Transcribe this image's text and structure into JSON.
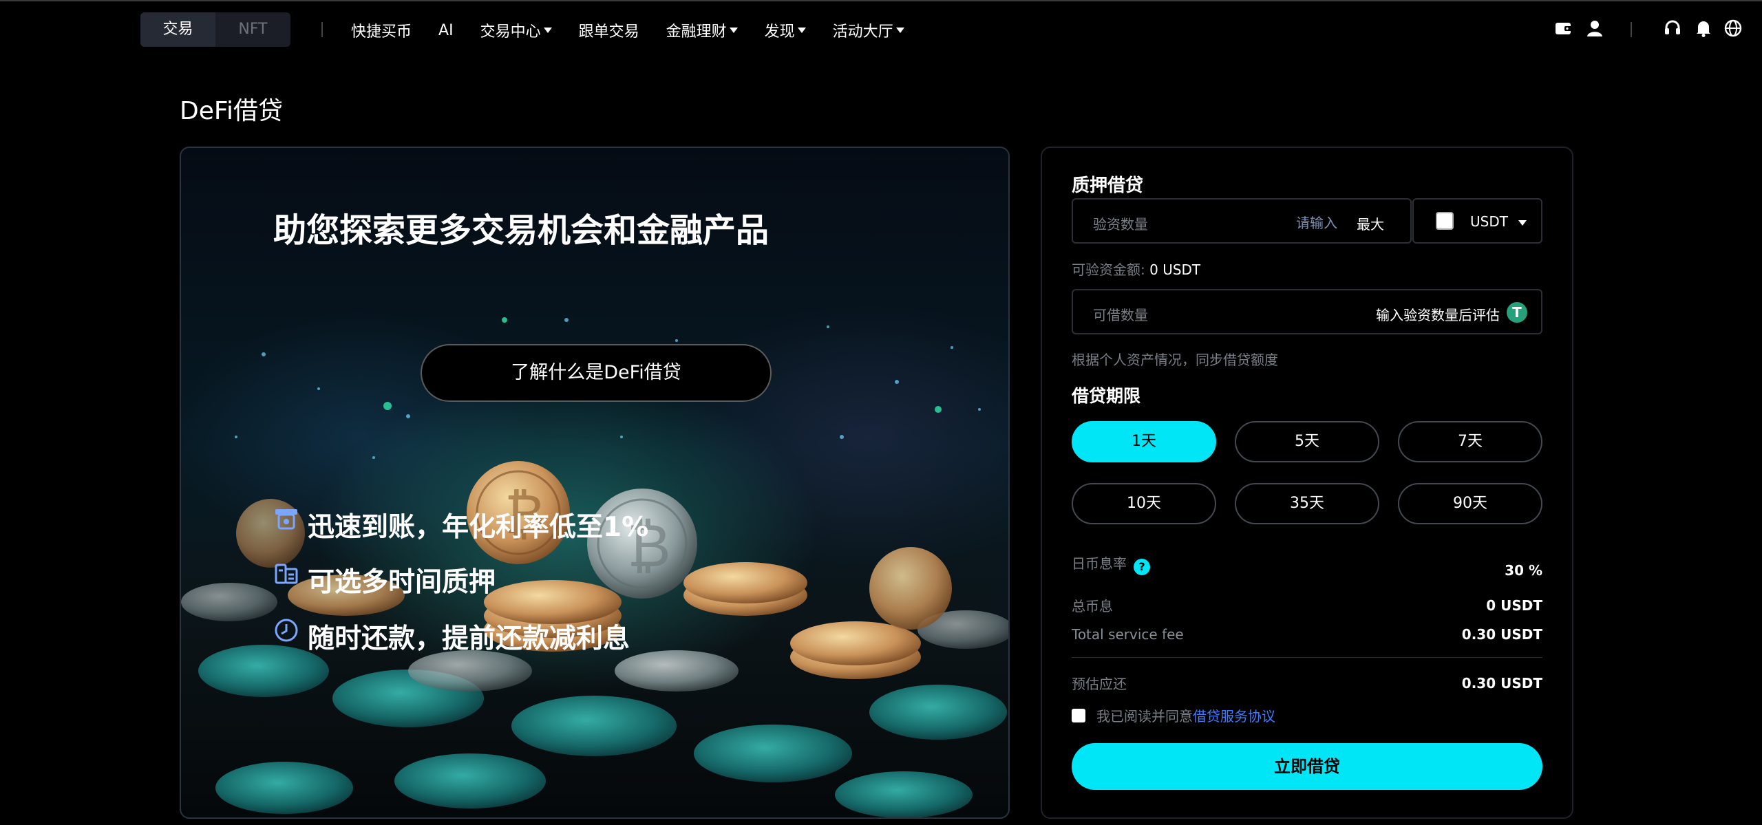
{
  "nav": {
    "segment": [
      "交易",
      "NFT"
    ],
    "menu": [
      {
        "label": "快捷买币",
        "dropdown": false
      },
      {
        "label": "AI",
        "dropdown": false
      },
      {
        "label": "交易中心",
        "dropdown": true
      },
      {
        "label": "跟单交易",
        "dropdown": false
      },
      {
        "label": "金融理财",
        "dropdown": true
      },
      {
        "label": "发现",
        "dropdown": true
      },
      {
        "label": "活动大厅",
        "dropdown": true
      }
    ],
    "right_icons": [
      "wallet-icon",
      "user-icon",
      "headset-icon",
      "bell-icon",
      "globe-icon"
    ]
  },
  "page": {
    "title": "DeFi借贷"
  },
  "hero": {
    "headline": "助您探索更多交易机会和金融产品",
    "learn_button": "了解什么是DeFi借贷",
    "features": [
      {
        "icon": "deposit-icon",
        "text": "迅速到账，年化利率低至1%"
      },
      {
        "icon": "stack-icon",
        "text": "可选多时间质押"
      },
      {
        "icon": "clock-icon",
        "text": "随时还款，提前还款减利息"
      }
    ]
  },
  "panel": {
    "title": "质押借贷",
    "collateral": {
      "placeholder": "验资数量",
      "hint": "请输入",
      "max": "最大",
      "coin": "USDT"
    },
    "available": {
      "label": "可验资金额:",
      "value": "0 USDT"
    },
    "borrowable": {
      "placeholder": "可借数量",
      "hint": "输入验资数量后评估"
    },
    "note": "根据个人资产情况，同步借贷额度",
    "term_title": "借贷期限",
    "terms": [
      "1天",
      "5天",
      "7天",
      "10天",
      "35天",
      "90天"
    ],
    "selected_term": "1天",
    "rate": {
      "label": "日币息率",
      "value": "30 %"
    },
    "total_interest": {
      "label": "总币息",
      "value": "0 USDT"
    },
    "service_fee": {
      "label": "Total service fee",
      "value": "0.30 USDT"
    },
    "repay": {
      "label": "预估应还",
      "value": "0.30 USDT"
    },
    "agree": {
      "text": "我已阅读并同意",
      "link": "借贷服务协议"
    },
    "submit": "立即借贷"
  },
  "colors": {
    "accent": "#00e6f6",
    "link": "#3d7bff",
    "tether": "#26a17b"
  }
}
